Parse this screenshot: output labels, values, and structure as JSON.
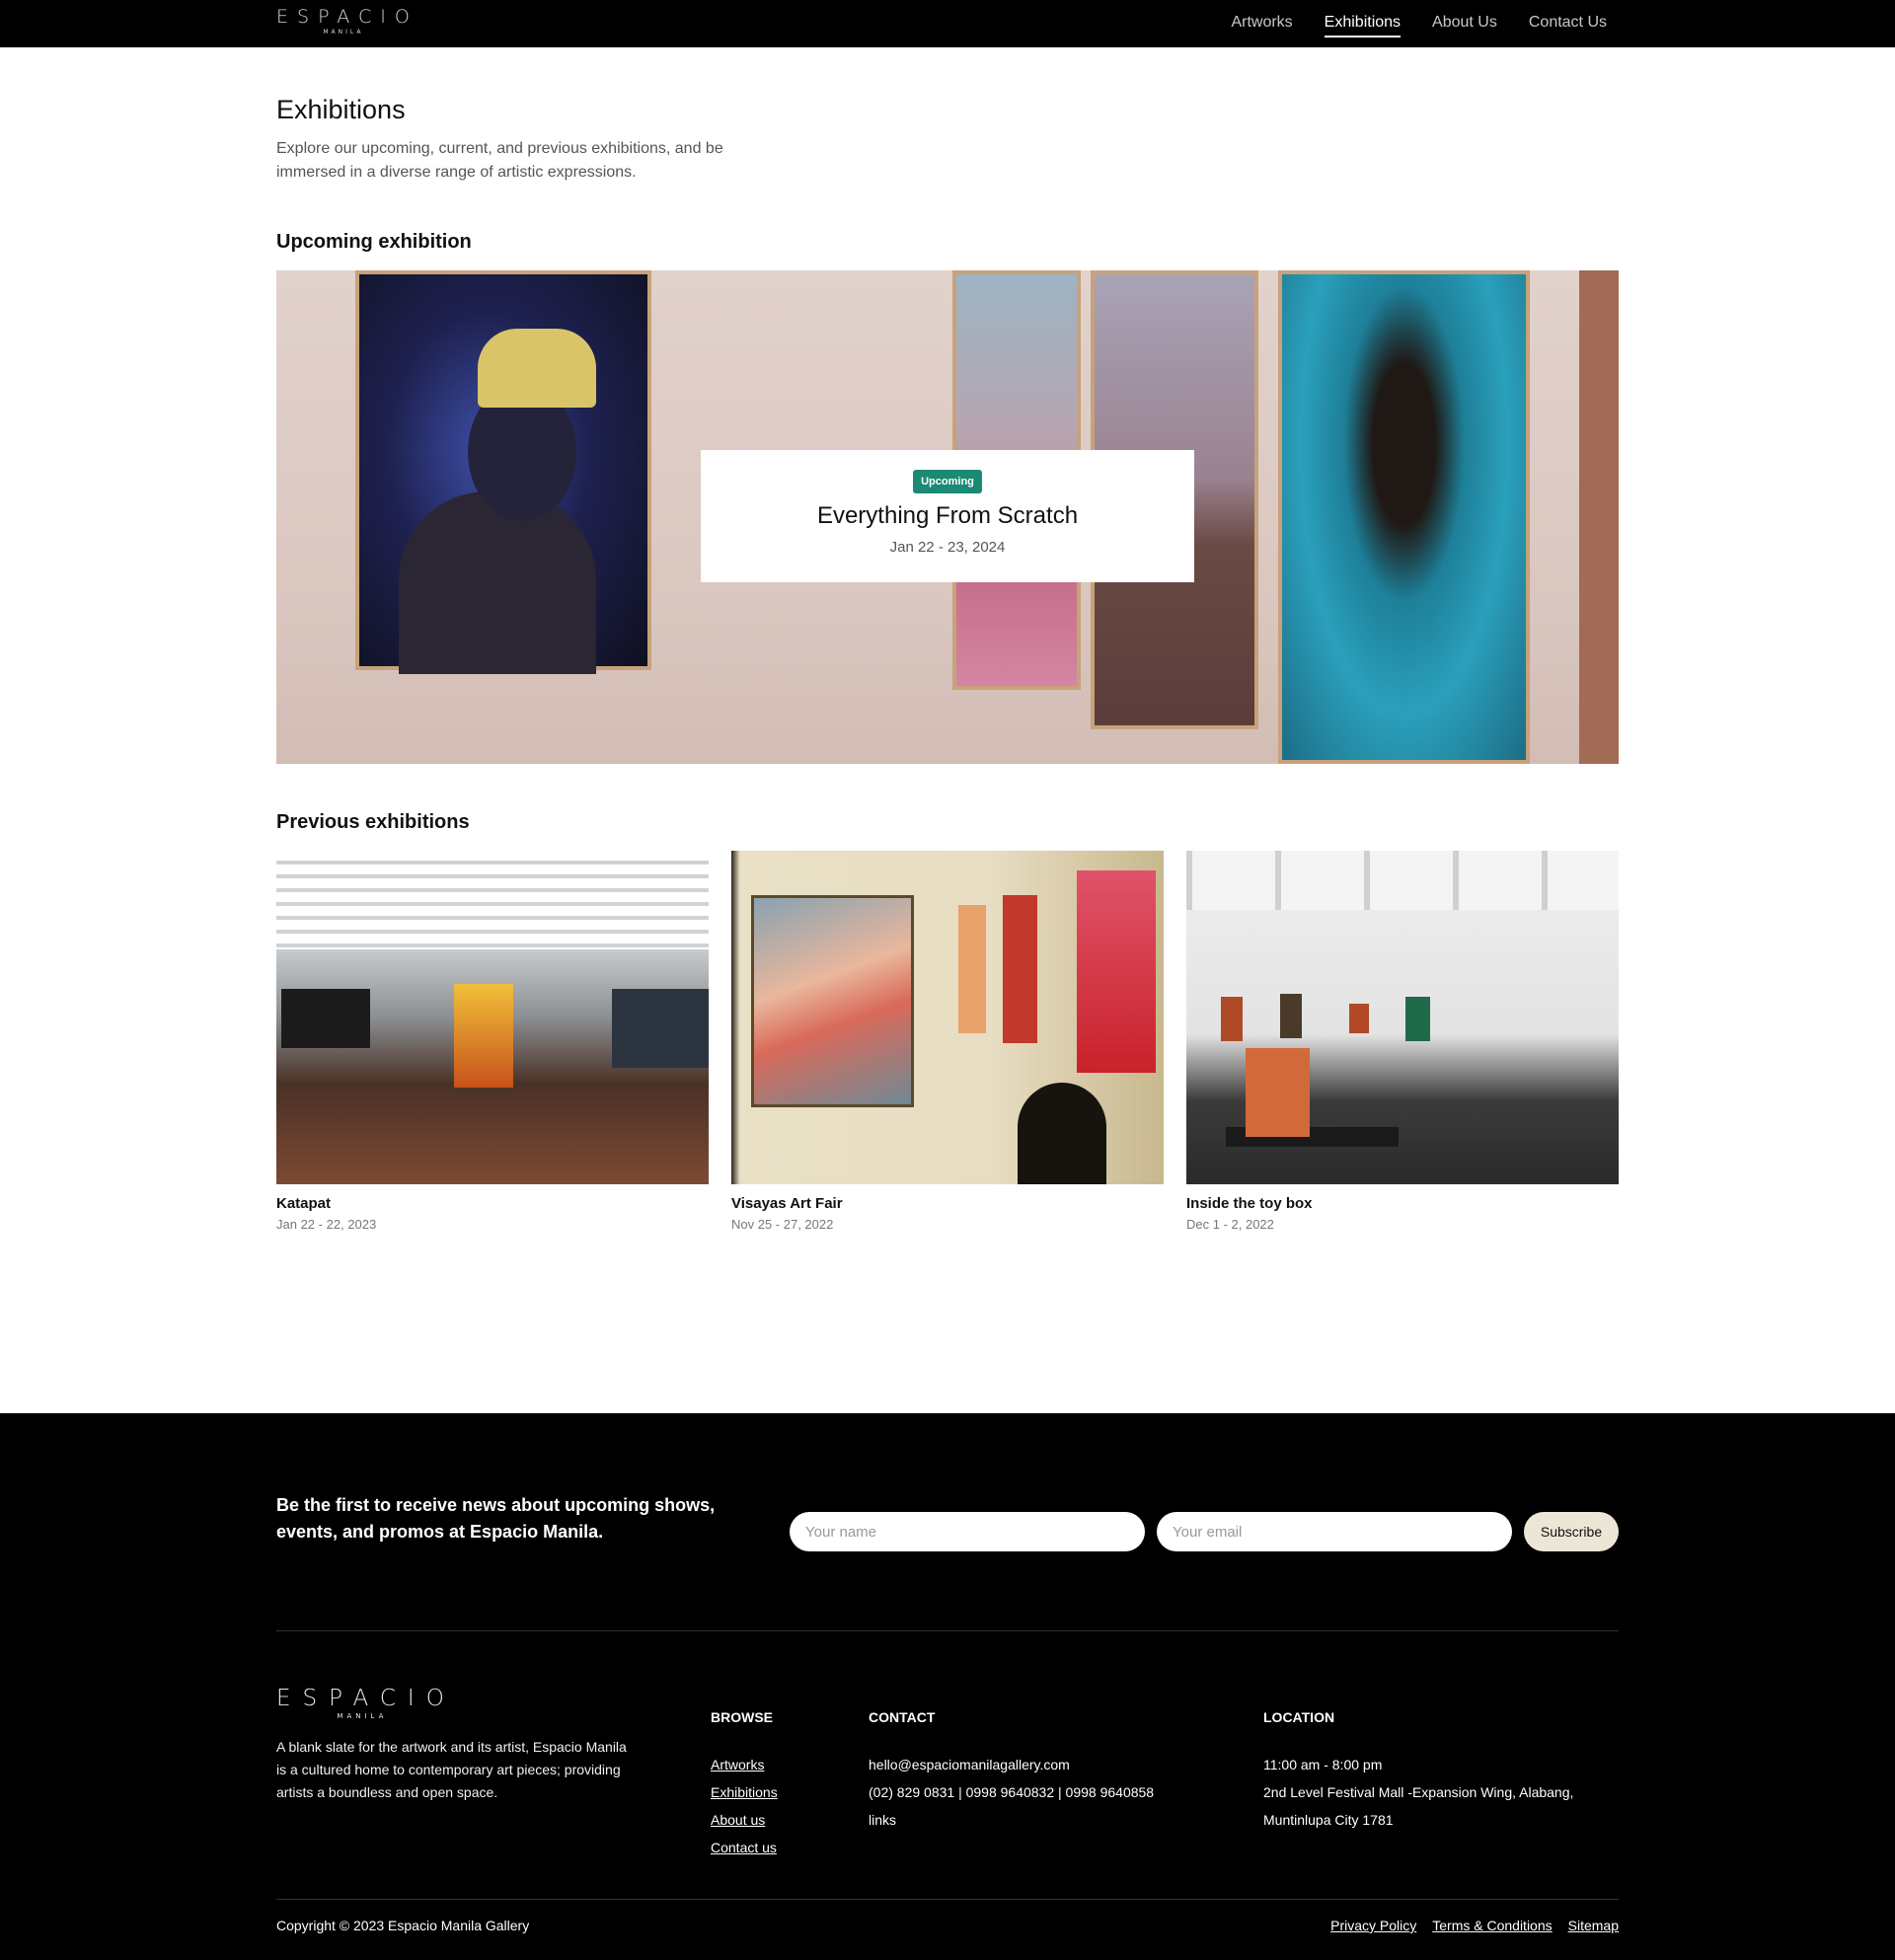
{
  "nav": {
    "logo_word": "ESPACIO",
    "logo_sub": "MANILA",
    "links": [
      "Artworks",
      "Exhibitions",
      "About Us",
      "Contact Us"
    ],
    "active": "Exhibitions"
  },
  "header": {
    "title": "Exhibitions",
    "intro": "Explore our upcoming, current, and previous exhibitions, and be immersed in a diverse range of artistic expressions."
  },
  "upcoming": {
    "heading": "Upcoming exhibition",
    "badge": "Upcoming",
    "title": "Everything From Scratch",
    "dates": "Jan 22 - 23, 2024",
    "badge_color": "#1b8a74"
  },
  "previous": {
    "heading": "Previous exhibitions",
    "items": [
      {
        "title": "Katapat",
        "dates": "Jan 22 - 22, 2023"
      },
      {
        "title": "Visayas Art Fair",
        "dates": "Nov 25 - 27, 2022"
      },
      {
        "title": "Inside the toy box",
        "dates": "Dec 1 - 2, 2022"
      }
    ]
  },
  "newsletter": {
    "text": "Be the first to receive news about upcoming shows, events, and promos at Espacio Manila.",
    "name_placeholder": "Your name",
    "email_placeholder": "Your email",
    "button": "Subscribe"
  },
  "footer": {
    "logo_word": "ESPACIO",
    "logo_sub": "MANILA",
    "about": "A blank slate for the artwork and its artist, Espacio Manila is a cultured home to contemporary art pieces; providing artists a boundless and open space.",
    "browse_title": "BROWSE",
    "browse": [
      "Artworks",
      "Exhibitions",
      "About us",
      "Contact us"
    ],
    "contact_title": "CONTACT",
    "contact": [
      "hello@espaciomanilagallery.com",
      "(02) 829 0831 | 0998 9640832 | 0998 9640858",
      "links"
    ],
    "location_title": "LOCATION",
    "location": [
      "11:00 am - 8:00 pm",
      "2nd Level Festival Mall -Expansion Wing, Alabang,",
      "Muntinlupa City 1781"
    ],
    "copyright": "Copyright © 2023 Espacio Manila Gallery",
    "legal": [
      "Privacy Policy",
      "Terms & Conditions",
      "Sitemap"
    ]
  }
}
